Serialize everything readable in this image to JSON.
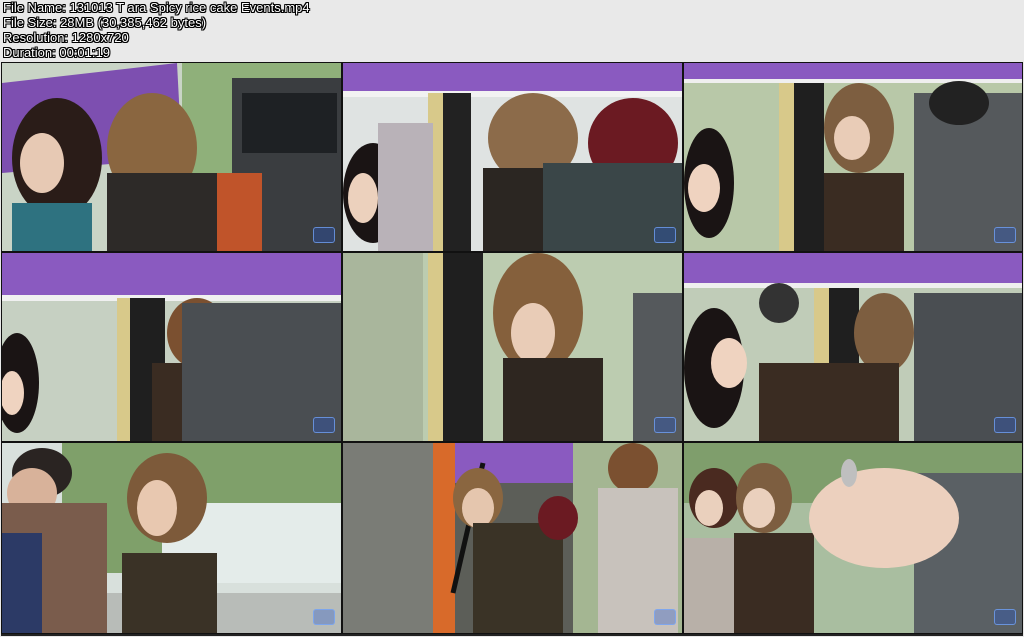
{
  "file_info": {
    "name_line": "File Name: 131013 T ara Spicy rice cake Events.mp4",
    "size_line": "File Size: 28MB (30,385,462 bytes)",
    "resolution_line": "Resolution: 1280x720",
    "duration_line": "Duration: 00:01:19"
  },
  "thumbnails": [
    {
      "id": 1,
      "scene": "purple-banner-car"
    },
    {
      "id": 2,
      "scene": "truck-interior"
    },
    {
      "id": 3,
      "scene": "truck-interior"
    },
    {
      "id": 4,
      "scene": "truck-interior"
    },
    {
      "id": 5,
      "scene": "truck-interior"
    },
    {
      "id": 6,
      "scene": "truck-interior"
    },
    {
      "id": 7,
      "scene": "street-trees"
    },
    {
      "id": 8,
      "scene": "truck-side-orange"
    },
    {
      "id": 9,
      "scene": "street-group-hand"
    }
  ],
  "colors": {
    "purple_banner": "#7d4fb0",
    "dark_hair": "#2a1c18",
    "brown_hair": "#7a5a3c",
    "jacket_gray": "#4a4e52",
    "sky": "#e8eef0",
    "foliage": "#7fa06a"
  }
}
